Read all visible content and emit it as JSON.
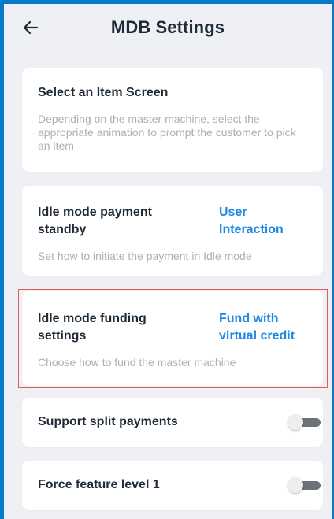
{
  "header": {
    "title": "MDB Settings",
    "back_icon": "arrow-left-icon"
  },
  "settings": [
    {
      "title": "Select an Item Screen",
      "description": "Depending on the master machine, select the appropriate animation to prompt the customer to pick an item"
    },
    {
      "title_line1": "Idle mode payment",
      "title_line2": "standby",
      "value_line1": "User",
      "value_line2": "Interaction",
      "description": "Set how to initiate the payment in Idle mode"
    },
    {
      "title_line1": "Idle mode funding",
      "title_line2": "settings",
      "value_line1": "Fund with",
      "value_line2": "virtual credit",
      "description": "Choose how to fund the master machine",
      "highlighted": true
    },
    {
      "title": "Support split payments",
      "toggle_on": false
    },
    {
      "title": "Force feature level 1",
      "toggle_on": false
    }
  ],
  "colors": {
    "accent": "#1e88e5",
    "highlight_border": "#e45a5a",
    "page_background": "#eef0f3",
    "outer_frame": "#0a78c9"
  }
}
